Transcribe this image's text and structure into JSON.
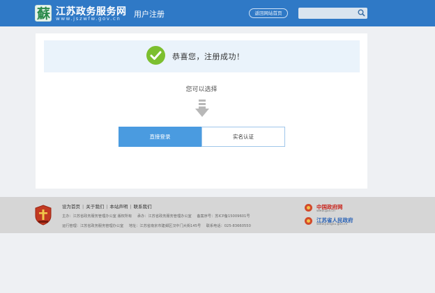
{
  "header": {
    "logo_glyph": "蘇",
    "site_title": "江苏政务服务网",
    "site_url": "www.jszwfw.gov.cn",
    "page_name": "用户注册",
    "home_button": "返回网站首页",
    "search_placeholder": ""
  },
  "main": {
    "success_message": "恭喜您，注册成功！",
    "choose_prompt": "您可以选择",
    "login_button": "直接登录",
    "verify_button": "实名认证"
  },
  "footer": {
    "links": [
      "设为首页",
      "关于我们",
      "本站声明",
      "联系我们"
    ],
    "line1": [
      "主办：江苏省政务服务管理办公室 版权所有",
      "承办：江苏省政务服务管理办公室",
      "备案序号：苏ICP备15009601号"
    ],
    "line2": [
      "运行管理：江苏省政务服务管理办公室",
      "地址：江苏省南京市建邺区汉中门大街145号",
      "联系电话：025-83660550"
    ],
    "partners": [
      {
        "name": "中国政府网",
        "url": "www.gov.cn",
        "color": "#c8261e"
      },
      {
        "name": "江苏省人民政府",
        "url": "www.jiangsu.gov.cn",
        "color": "#2a62b5"
      }
    ]
  },
  "colors": {
    "header_bg": "#2f79c6",
    "primary_button": "#4a9be0",
    "success_check": "#7cbf2f"
  }
}
